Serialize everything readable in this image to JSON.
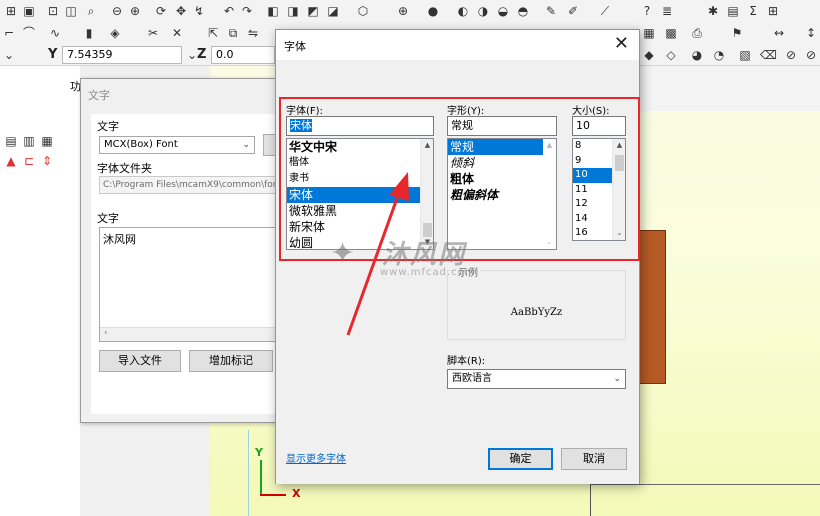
{
  "cad": {
    "coords": {
      "y_label": "Y",
      "y_value": "7.54359",
      "z_label": "Z",
      "z_value": "0.0"
    },
    "side_text": "功",
    "axes": {
      "y": "Y",
      "x": "X"
    }
  },
  "text_dialog": {
    "title": "文字",
    "font_group_label": "文字",
    "font_combo_value": "MCX(Box) Font",
    "font_folder_label": "字体文件夹",
    "font_folder_path": "C:\\Program Files\\mcamX9\\common\\fonts\\",
    "text_label": "文字",
    "text_value": "沐风网",
    "import_button": "导入文件",
    "add_mark_button": "增加标记"
  },
  "font_dialog": {
    "title": "字体",
    "close_glyph": "✕",
    "font_label": "字体(F):",
    "font_value": "宋体",
    "font_list": [
      "华文中宋",
      "楷体",
      "隶书",
      "宋体",
      "微软雅黑",
      "新宋体",
      "幼圆"
    ],
    "font_selected": "宋体",
    "style_label": "字形(Y):",
    "style_value": "常规",
    "style_list": [
      "常规",
      "倾斜",
      "粗体",
      "粗偏斜体"
    ],
    "style_selected": "常规",
    "size_label": "大小(S):",
    "size_value": "10",
    "size_list": [
      "8",
      "9",
      "10",
      "11",
      "12",
      "14",
      "16"
    ],
    "size_selected": "10",
    "sample_label": "示例",
    "sample_text": "AaBbYyZz",
    "script_label": "脚本(R):",
    "script_value": "西欧语言",
    "more_fonts_link": "显示更多字体",
    "ok_button": "确定",
    "cancel_button": "取消"
  },
  "watermark": {
    "name": "沐风网",
    "url": "www.mfcad.com"
  },
  "colors": {
    "highlight": "#0078d7",
    "annotation_red": "#e7272c",
    "part_brown": "#b65a25"
  }
}
